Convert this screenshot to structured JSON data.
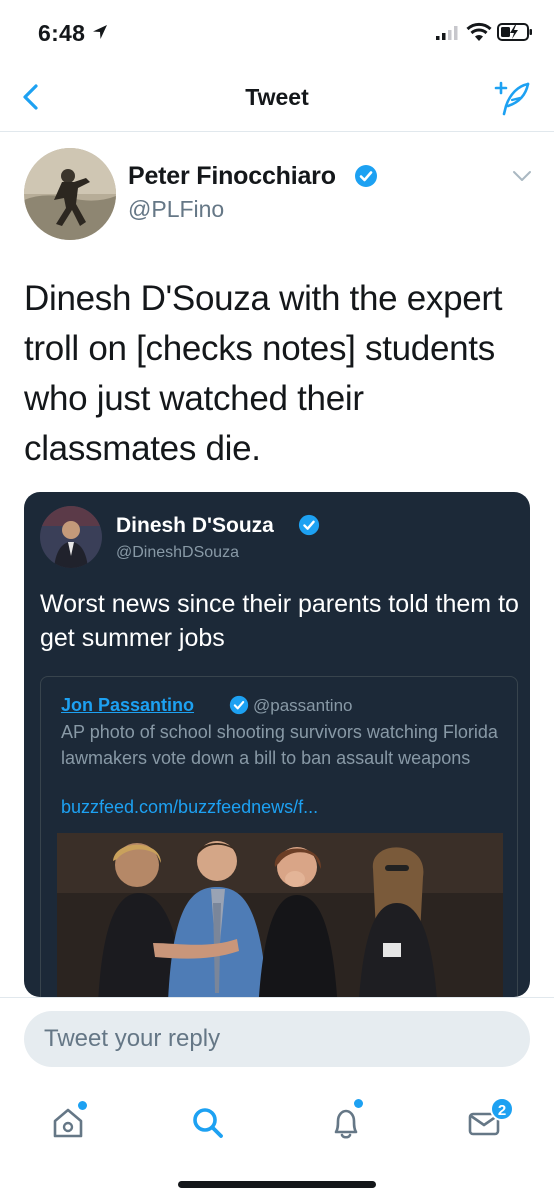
{
  "status_bar": {
    "time": "6:48"
  },
  "nav": {
    "title": "Tweet"
  },
  "tweet": {
    "author_name": "Peter Finocchiaro",
    "author_handle": "@PLFino",
    "text": "Dinesh D'Souza with the expert troll on [checks notes] students who just watched their classmates die.",
    "verified": true
  },
  "embedded": {
    "author_name": "Dinesh D'Souza",
    "author_handle": "@DineshDSouza",
    "text": "Worst news since their parents told them to get summer jobs",
    "quote": {
      "author_name": "Jon Passantino",
      "author_handle": "@passantino",
      "text": "AP photo of school shooting survivors watching Florida lawmakers vote down a bill to ban assault weapons",
      "link": "buzzfeed.com/buzzfeednews/f..."
    }
  },
  "reply": {
    "placeholder": "Tweet your reply"
  },
  "tab_bar": {
    "messages_badge": "2"
  },
  "colors": {
    "accent": "#1da1f2",
    "text": "#14171a",
    "secondary": "#657786",
    "embed_bg": "#1c2938"
  }
}
